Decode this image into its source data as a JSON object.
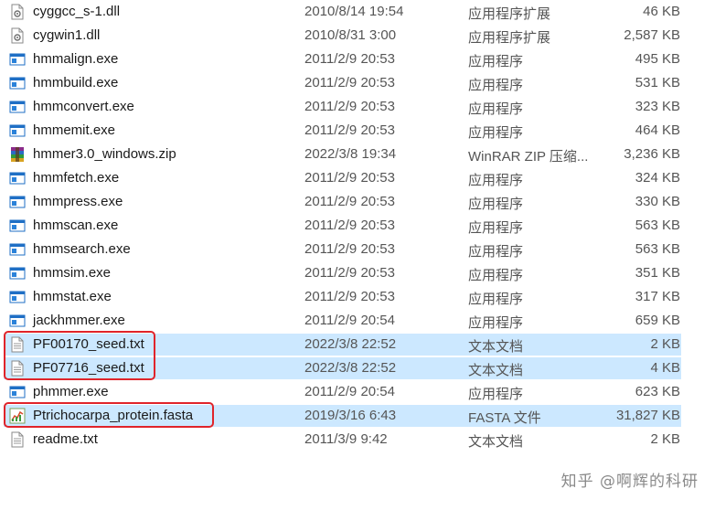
{
  "files": [
    {
      "name": "cyggcc_s-1.dll",
      "date": "2010/8/14 19:54",
      "type": "应用程序扩展",
      "size": "46 KB",
      "icon": "dll-gear-icon",
      "selected": false
    },
    {
      "name": "cygwin1.dll",
      "date": "2010/8/31 3:00",
      "type": "应用程序扩展",
      "size": "2,587 KB",
      "icon": "dll-gear-icon",
      "selected": false
    },
    {
      "name": "hmmalign.exe",
      "date": "2011/2/9 20:53",
      "type": "应用程序",
      "size": "495 KB",
      "icon": "exe-window-icon",
      "selected": false
    },
    {
      "name": "hmmbuild.exe",
      "date": "2011/2/9 20:53",
      "type": "应用程序",
      "size": "531 KB",
      "icon": "exe-window-icon",
      "selected": false
    },
    {
      "name": "hmmconvert.exe",
      "date": "2011/2/9 20:53",
      "type": "应用程序",
      "size": "323 KB",
      "icon": "exe-window-icon",
      "selected": false
    },
    {
      "name": "hmmemit.exe",
      "date": "2011/2/9 20:53",
      "type": "应用程序",
      "size": "464 KB",
      "icon": "exe-window-icon",
      "selected": false
    },
    {
      "name": "hmmer3.0_windows.zip",
      "date": "2022/3/8 19:34",
      "type": "WinRAR ZIP 压缩...",
      "size": "3,236 KB",
      "icon": "winrar-zip-icon",
      "selected": false
    },
    {
      "name": "hmmfetch.exe",
      "date": "2011/2/9 20:53",
      "type": "应用程序",
      "size": "324 KB",
      "icon": "exe-window-icon",
      "selected": false
    },
    {
      "name": "hmmpress.exe",
      "date": "2011/2/9 20:53",
      "type": "应用程序",
      "size": "330 KB",
      "icon": "exe-window-icon",
      "selected": false
    },
    {
      "name": "hmmscan.exe",
      "date": "2011/2/9 20:53",
      "type": "应用程序",
      "size": "563 KB",
      "icon": "exe-window-icon",
      "selected": false
    },
    {
      "name": "hmmsearch.exe",
      "date": "2011/2/9 20:53",
      "type": "应用程序",
      "size": "563 KB",
      "icon": "exe-window-icon",
      "selected": false
    },
    {
      "name": "hmmsim.exe",
      "date": "2011/2/9 20:53",
      "type": "应用程序",
      "size": "351 KB",
      "icon": "exe-window-icon",
      "selected": false
    },
    {
      "name": "hmmstat.exe",
      "date": "2011/2/9 20:53",
      "type": "应用程序",
      "size": "317 KB",
      "icon": "exe-window-icon",
      "selected": false
    },
    {
      "name": "jackhmmer.exe",
      "date": "2011/2/9 20:54",
      "type": "应用程序",
      "size": "659 KB",
      "icon": "exe-window-icon",
      "selected": false
    },
    {
      "name": "PF00170_seed.txt",
      "date": "2022/3/8 22:52",
      "type": "文本文档",
      "size": "2 KB",
      "icon": "text-document-icon",
      "selected": true
    },
    {
      "name": "PF07716_seed.txt",
      "date": "2022/3/8 22:52",
      "type": "文本文档",
      "size": "4 KB",
      "icon": "text-document-icon",
      "selected": true
    },
    {
      "name": "phmmer.exe",
      "date": "2011/2/9 20:54",
      "type": "应用程序",
      "size": "623 KB",
      "icon": "exe-window-icon",
      "selected": false
    },
    {
      "name": "Ptrichocarpa_protein.fasta",
      "date": "2019/3/16 6:43",
      "type": "FASTA 文件",
      "size": "31,827 KB",
      "icon": "fasta-chart-icon",
      "selected": true
    },
    {
      "name": "readme.txt",
      "date": "2011/3/9 9:42",
      "type": "文本文档",
      "size": "2 KB",
      "icon": "text-document-icon",
      "selected": false
    }
  ],
  "watermark": "知乎 @啊辉的科研",
  "colors": {
    "selection": "#cce8ff",
    "highlight_box": "#e0242a"
  }
}
